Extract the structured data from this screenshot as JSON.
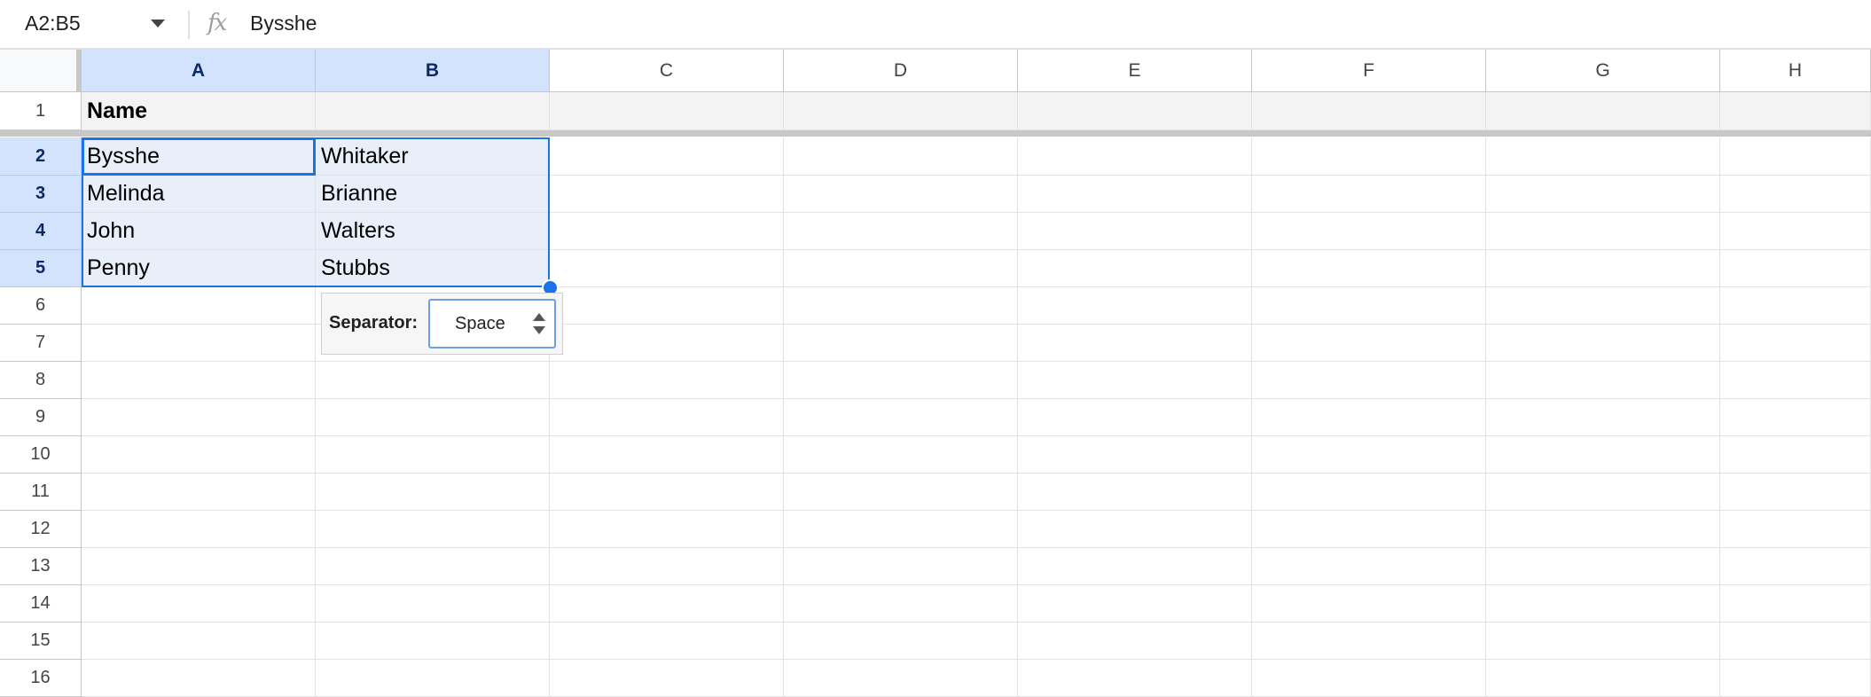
{
  "formula_bar": {
    "name_box": "A2:B5",
    "fx_icon": "function-icon",
    "formula": "Bysshe"
  },
  "columns": [
    "A",
    "B",
    "C",
    "D",
    "E",
    "F",
    "G",
    "H"
  ],
  "rows": [
    "1",
    "2",
    "3",
    "4",
    "5",
    "6",
    "7",
    "8",
    "9",
    "10",
    "11",
    "12",
    "13",
    "14",
    "15",
    "16"
  ],
  "cells": {
    "A1": "Name",
    "A2": "Bysshe",
    "B2": "Whitaker",
    "A3": "Melinda",
    "B3": "Brianne",
    "A4": "John",
    "B4": "Walters",
    "A5": "Penny",
    "B5": "Stubbs"
  },
  "separator_popup": {
    "label": "Separator:",
    "selected": "Space"
  },
  "colors": {
    "selection_border": "#1a73e8",
    "header_selected_bg": "#d3e3fd",
    "selection_fill": "#e8eff9"
  }
}
